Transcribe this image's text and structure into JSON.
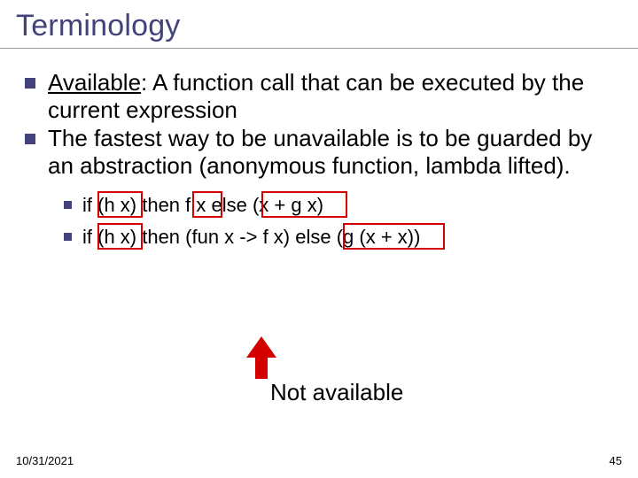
{
  "title": "Terminology",
  "bullets": [
    {
      "term": "Available",
      "rest": ": A function call that can be executed by the current expression"
    },
    {
      "text": "The fastest way to be unavailable is to be guarded by an abstraction (anonymous function, lambda lifted)."
    }
  ],
  "examples": [
    "if (h x) then f x else (x + g x)",
    "if (h x) then (fun x -> f x) else (g (x + x))"
  ],
  "annotation": "Not available",
  "footer": {
    "date": "10/31/2021",
    "page": "45"
  }
}
